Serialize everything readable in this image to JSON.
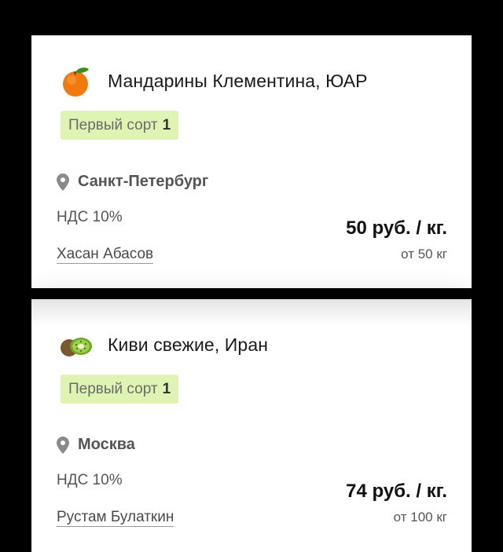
{
  "colors": {
    "background": "#000000",
    "card": "#ffffff",
    "grade_badge_bg": "#dff4b3",
    "text_primary": "#111111",
    "text_secondary": "#555555"
  },
  "offers": [
    {
      "icon": "tangerine-icon",
      "title": "Мандарины Клементина, ЮАР",
      "grade_label": "Первый сорт",
      "grade_number": "1",
      "location_icon": "location-pin-icon",
      "city": "Санкт-Петербург",
      "vat": "НДС 10%",
      "seller": "Хасан Абасов",
      "price": "50 руб. / кг.",
      "min_quantity": "от 50 кг"
    },
    {
      "icon": "kiwi-icon",
      "title": "Киви свежие, Иран",
      "grade_label": "Первый сорт",
      "grade_number": "1",
      "location_icon": "location-pin-icon",
      "city": "Москва",
      "vat": "НДС 10%",
      "seller": "Рустам Булаткин",
      "price": "74 руб. / кг.",
      "min_quantity": "от 100 кг"
    }
  ]
}
